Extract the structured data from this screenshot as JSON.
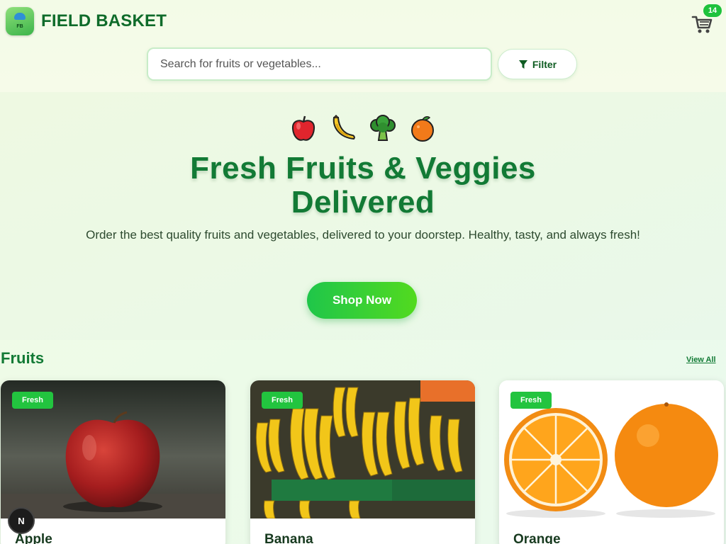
{
  "brand": {
    "name": "FIELD BASKET",
    "logo_letters": "FB"
  },
  "cart": {
    "icon": "cart-icon",
    "count": "14"
  },
  "search": {
    "placeholder": "Search for fruits or vegetables..."
  },
  "filter": {
    "label": "Filter",
    "icon": "filter-icon"
  },
  "hero": {
    "emojis": [
      "apple-icon",
      "banana-icon",
      "broccoli-icon",
      "orange-icon"
    ],
    "title_line1": "Fresh Fruits & Veggies",
    "title_line2": "Delivered",
    "subtitle": "Order the best quality fruits and vegetables, delivered to your doorstep. Healthy, tasty, and always fresh!",
    "cta": "Shop Now"
  },
  "section": {
    "title": "Fruits",
    "view_all": "View All",
    "products": [
      {
        "name": "Apple",
        "badge": "Fresh"
      },
      {
        "name": "Banana",
        "badge": "Fresh"
      },
      {
        "name": "Orange",
        "badge": "Fresh"
      }
    ]
  },
  "user": {
    "avatar_initial": "N"
  },
  "colors": {
    "brand_green": "#127a35",
    "accent_green": "#22c43f"
  }
}
